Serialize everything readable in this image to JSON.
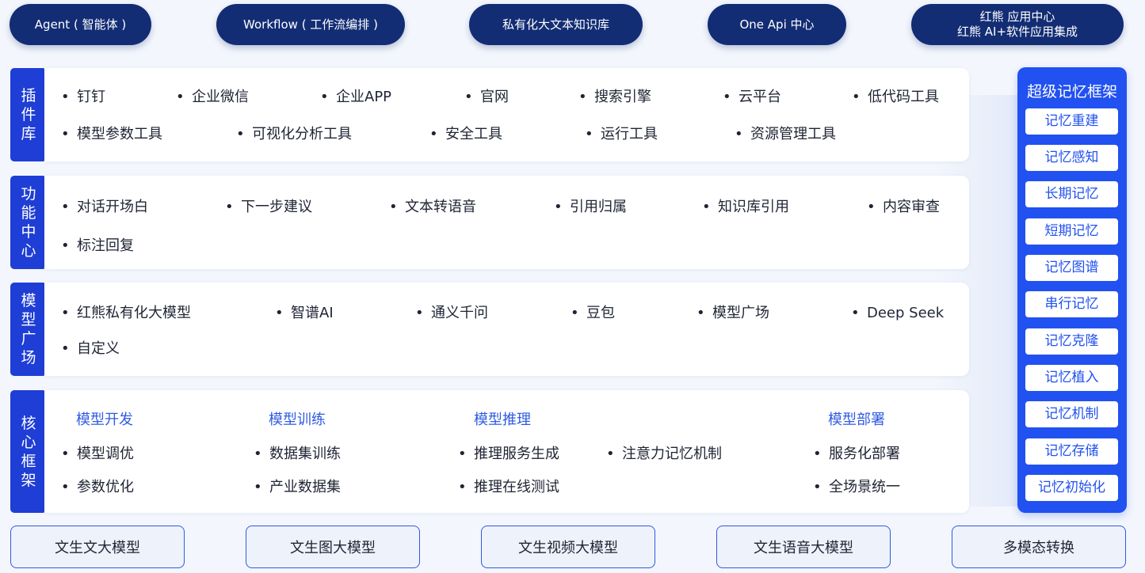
{
  "top_pills": [
    {
      "label": "Agent ( 智能体 )"
    },
    {
      "label": "Workflow ( 工作流编排 )"
    },
    {
      "label": "私有化大文本知识库"
    },
    {
      "label": "One Api 中心"
    },
    {
      "line1": "红熊 应用中心",
      "line2": "红熊 AI+软件应用集成"
    }
  ],
  "sections": {
    "plugins": {
      "title": "插件库",
      "items": [
        "钉钉",
        "企业微信",
        "企业APP",
        "官网",
        "搜索引擎",
        "云平台",
        "低代码工具",
        "模型参数工具",
        "可视化分析工具",
        "安全工具",
        "运行工具",
        "资源管理工具"
      ]
    },
    "functions": {
      "title": "功能中心",
      "items": [
        "对话开场白",
        "下一步建议",
        "文本转语音",
        "引用归属",
        "知识库引用",
        "内容审查",
        "标注回复"
      ]
    },
    "models": {
      "title": "模型广场",
      "items": [
        "红熊私有化大模型",
        "智谱AI",
        "通义千问",
        "豆包",
        "模型广场",
        "Deep Seek",
        "自定义"
      ]
    },
    "core": {
      "title": "核心框架",
      "groups": [
        {
          "heading": "模型开发",
          "items": [
            "模型调优",
            "参数优化"
          ]
        },
        {
          "heading": "模型训练",
          "items": [
            "数据集训练",
            "产业数据集"
          ]
        },
        {
          "heading": "模型推理",
          "items": [
            "推理服务生成",
            "推理在线测试",
            "注意力记忆机制"
          ]
        },
        {
          "heading": "模型部署",
          "items": [
            "服务化部署",
            "全场景统一"
          ]
        }
      ]
    }
  },
  "memory": {
    "title": "超级记忆框架",
    "items": [
      "记忆重建",
      "记忆感知",
      "长期记忆",
      "短期记忆",
      "记忆图谱",
      "串行记忆",
      "记忆克隆",
      "记忆植入",
      "记忆机制",
      "记忆存储",
      "记忆初始化"
    ]
  },
  "bottom": [
    "文生文大模型",
    "文生图大模型",
    "文生视频大模型",
    "文生语音大模型",
    "多模态转换"
  ],
  "colors": {
    "navy": "#132d74",
    "blue": "#1f3ed6",
    "memory_blue": "#2151f0",
    "accent_text": "#2f5be0"
  }
}
